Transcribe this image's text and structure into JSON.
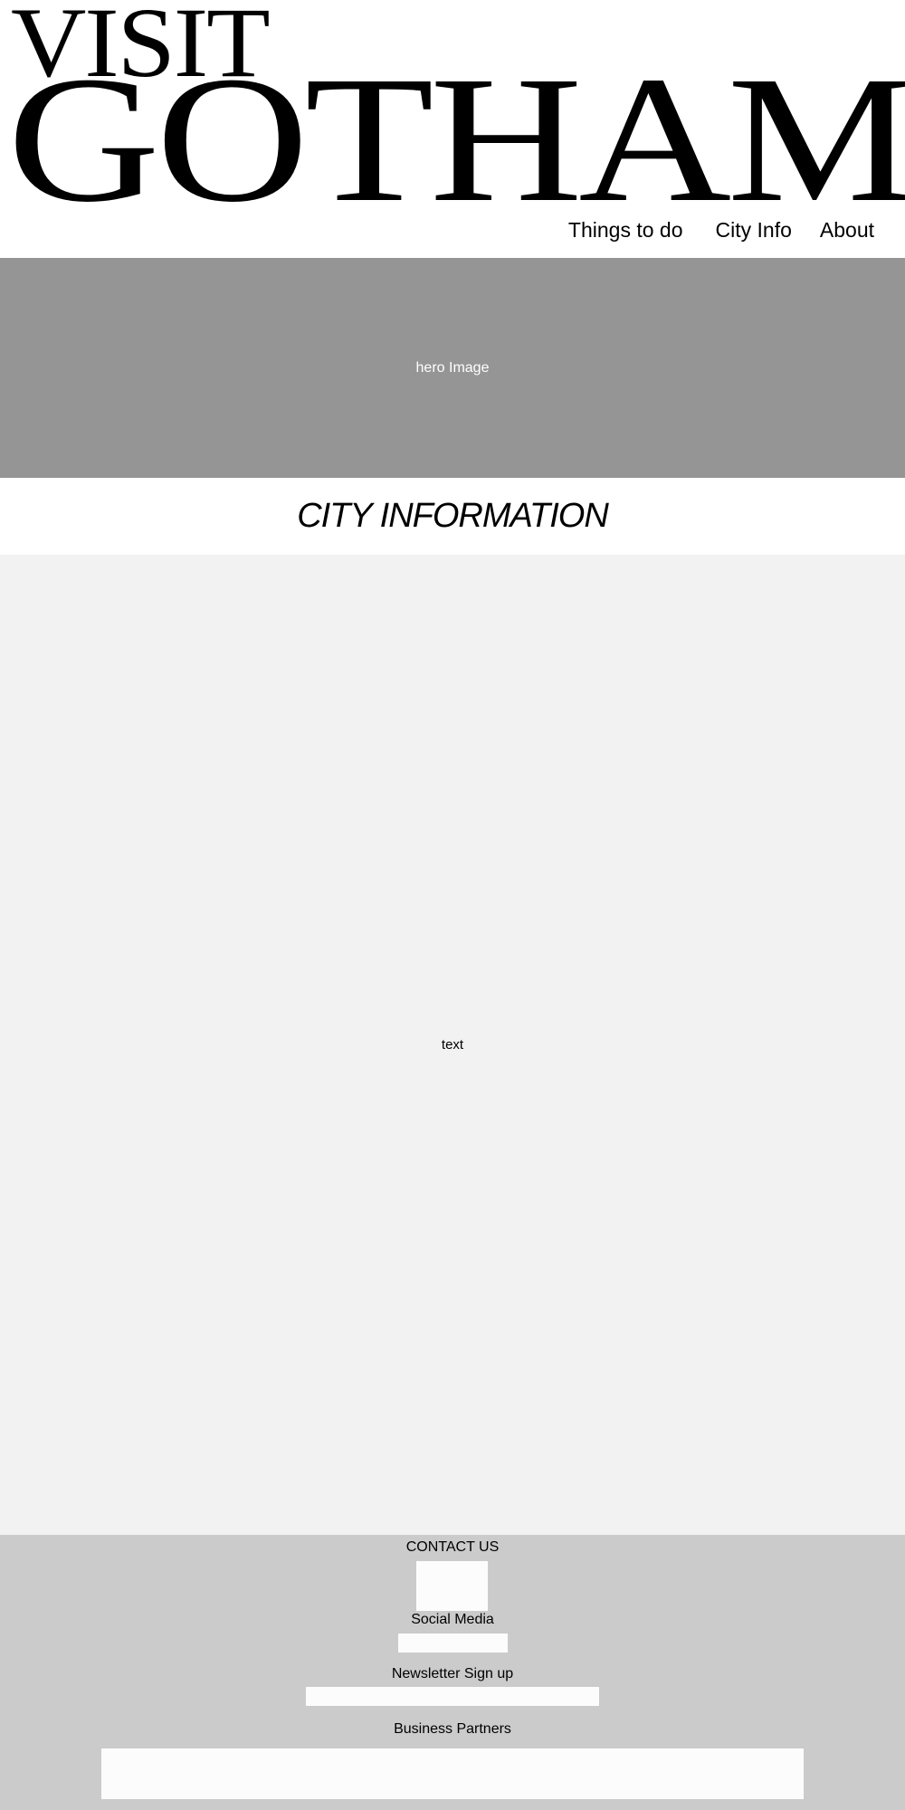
{
  "header": {
    "logo_line1": "VISIT",
    "logo_line2": "GOTHAM"
  },
  "nav": {
    "items": [
      {
        "label": "Things to do"
      },
      {
        "label": "City Info"
      },
      {
        "label": "About"
      }
    ]
  },
  "hero": {
    "label": "hero Image"
  },
  "section": {
    "title": "CITY INFORMATION"
  },
  "content": {
    "label": "text"
  },
  "footer": {
    "contact_label": "CONTACT US",
    "social_label": "Social Media",
    "newsletter_label": "Newsletter Sign up",
    "partners_label": "Business Partners"
  },
  "colors": {
    "hero_bg": "#959595",
    "content_bg": "#f2f2f2",
    "footer_bg": "#cbcbcb",
    "box_bg": "#fcfcfc"
  }
}
